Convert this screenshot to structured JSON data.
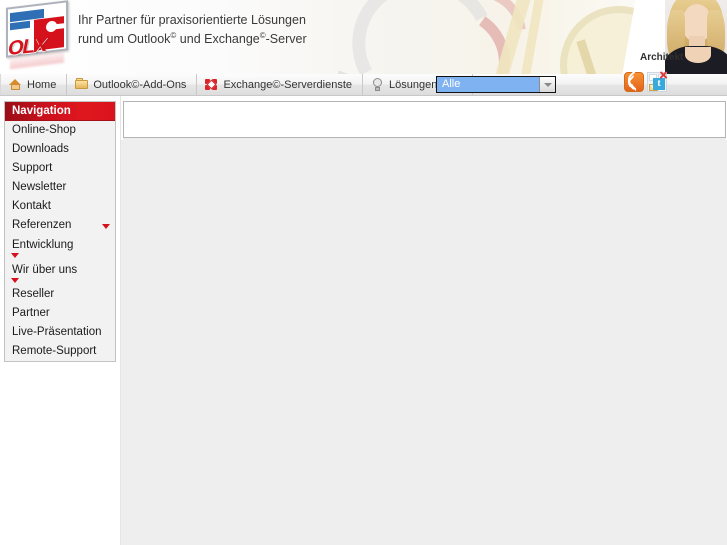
{
  "header": {
    "tagline_line1": "Ihr Partner für praxisorientierte Lösungen",
    "tagline_line2_pre": "rund um Outlook",
    "tagline_line2_mid": " und Exchange",
    "tagline_line2_post": "-Server",
    "sup": "©",
    "logo_text": "OLX",
    "architekt_label": "Architekt"
  },
  "tabs": [
    {
      "label": "Home",
      "icon": "home-icon"
    },
    {
      "label": "Outlook©-Add-Ons",
      "icon": "folder-icon"
    },
    {
      "label": "Exchange©-Serverdienste",
      "icon": "exchange-icon"
    },
    {
      "label": "Lösungen für...",
      "icon": "lightbulb-icon"
    }
  ],
  "search": {
    "selected_value": "Alle",
    "placeholder": "Alle"
  },
  "social": [
    {
      "name": "rss-icon",
      "label": "RSS"
    },
    {
      "name": "twitter-icon",
      "label": "Twitter"
    }
  ],
  "sidebar": {
    "title": "Navigation",
    "items": [
      {
        "label": "Online-Shop",
        "caret": false
      },
      {
        "label": "Downloads",
        "caret": false
      },
      {
        "label": "Support",
        "caret": false
      },
      {
        "label": "Newsletter",
        "caret": false
      },
      {
        "label": "Kontakt",
        "caret": false
      },
      {
        "label": "Referenzen",
        "caret": true
      },
      {
        "label": "Entwicklung",
        "caret": true
      },
      {
        "label": "Wir über uns",
        "caret": true
      },
      {
        "label": "Reseller",
        "caret": false
      },
      {
        "label": "Partner",
        "caret": false
      },
      {
        "label": "Live-Präsentation",
        "caret": false
      },
      {
        "label": "Remote-Support",
        "caret": false
      }
    ]
  },
  "content": {
    "panel_text": "",
    "body_text": ""
  },
  "colors": {
    "brand_red": "#d5121c",
    "nav_header_dark": "#9b0d16",
    "select_highlight": "#7fb2f0",
    "content_bg": "#eeeeee"
  }
}
